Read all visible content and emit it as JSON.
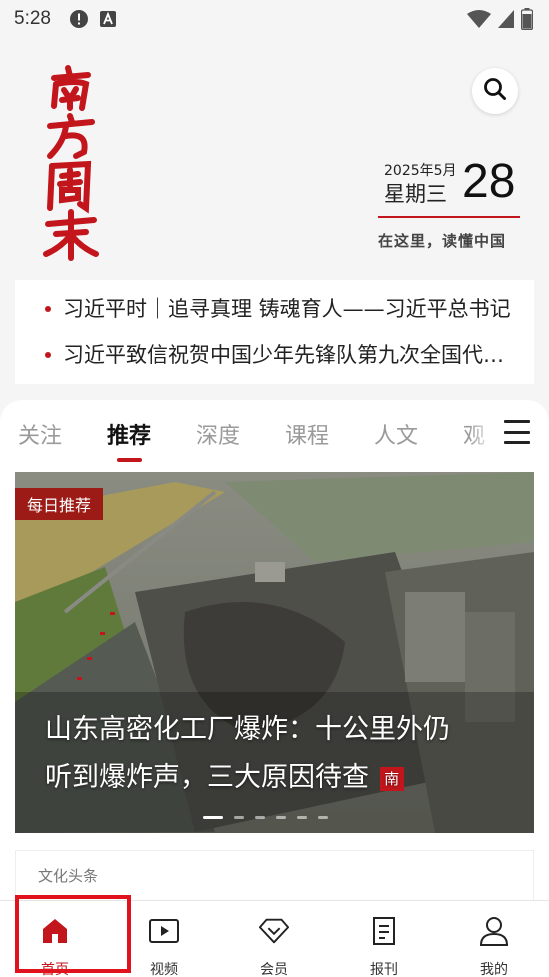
{
  "status_bar": {
    "time": "5:28"
  },
  "header": {
    "logo_text": "南方周末",
    "date_year_month": "2025年5月",
    "weekday": "星期三",
    "day": "28",
    "slogan": "在这里，读懂中国"
  },
  "headlines": [
    "习近平时｜追寻真理 铸魂育人——习近平总书记",
    "习近平致信祝贺中国少年先锋队第九次全国代表大会"
  ],
  "tabs": [
    "关注",
    "推荐",
    "深度",
    "课程",
    "人文",
    "观"
  ],
  "active_tab": "推荐",
  "feature": {
    "tag": "每日推荐",
    "title_line1": "山东高密化工厂爆炸：十公里外仍",
    "title_line2": "听到爆炸声，三大原因待查"
  },
  "culture_card": {
    "label": "文化头条"
  },
  "bottom_nav": [
    {
      "label": "首页",
      "icon": "home-icon"
    },
    {
      "label": "视频",
      "icon": "video-icon"
    },
    {
      "label": "会员",
      "icon": "diamond-icon"
    },
    {
      "label": "报刊",
      "icon": "newspaper-icon"
    },
    {
      "label": "我的",
      "icon": "person-icon"
    }
  ],
  "colors": {
    "accent": "#c3161c",
    "highlight": "#e0121e",
    "tag_bg": "#9d1b16"
  }
}
